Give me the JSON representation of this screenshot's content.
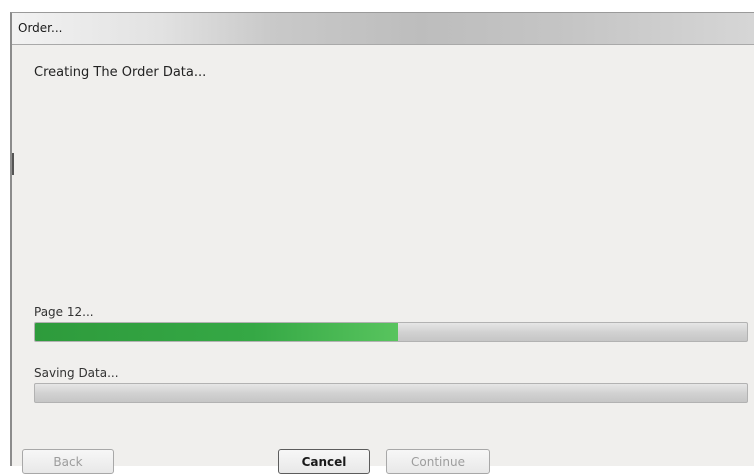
{
  "window": {
    "title": "Order..."
  },
  "status": {
    "header": "Creating The Order Data..."
  },
  "progress": [
    {
      "label": "Page 12...",
      "percent": 51,
      "fill_color": "#35a845"
    },
    {
      "label": "Saving Data...",
      "percent": 0,
      "fill_color": "#35a845"
    }
  ],
  "buttons": {
    "back": "Back",
    "cancel": "Cancel",
    "continue": "Continue"
  }
}
